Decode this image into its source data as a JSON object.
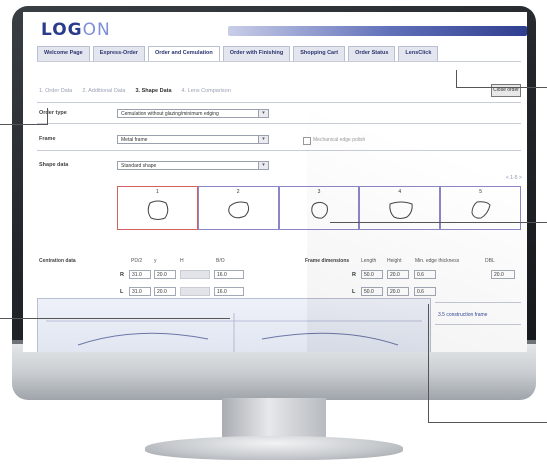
{
  "logo": {
    "left": "LOG",
    "right": "ON"
  },
  "nav": {
    "tabs": [
      "Welcome Page",
      "Express-Order",
      "Order and Cemulation",
      "Order with Finishing",
      "Shopping Cart",
      "Order Status",
      "LensClick"
    ],
    "active_index": 2
  },
  "steps": {
    "items": [
      "1. Order Data",
      "2. Additional Data",
      "3. Shape Data",
      "4. Lens Comparison"
    ],
    "current_index": 2
  },
  "close_button": "Close order",
  "form": {
    "order_type": {
      "label": "Order type",
      "value": "Cemulation without glazing/minimum edging"
    },
    "frame": {
      "label": "Frame",
      "value": "Metal frame",
      "checkbox_label": "Mechanical edge polish"
    },
    "shape_data": {
      "label": "Shape data",
      "value": "Standard shape"
    }
  },
  "shapes": {
    "pager": "< 1-5 >",
    "items": [
      {
        "number": "1",
        "selected": true,
        "icon": "lens-shape-rounded-square"
      },
      {
        "number": "2",
        "selected": false,
        "icon": "lens-shape-oval"
      },
      {
        "number": "3",
        "selected": false,
        "icon": "lens-shape-round"
      },
      {
        "number": "4",
        "selected": false,
        "icon": "lens-shape-wide"
      },
      {
        "number": "5",
        "selected": false,
        "icon": "lens-shape-teardrop"
      }
    ]
  },
  "centration": {
    "label": "Centration data",
    "columns": [
      "PD/2",
      "y",
      "H",
      "B/O"
    ],
    "rows": [
      {
        "side": "R",
        "values": [
          "31.0",
          "20.0",
          "",
          "16.0"
        ]
      },
      {
        "side": "L",
        "values": [
          "31.0",
          "20.0",
          "",
          "16.0"
        ]
      }
    ]
  },
  "frame_dimensions": {
    "label": "Frame dimensions",
    "columns": [
      "Length",
      "Height",
      "Min. edge thickness",
      "DBL"
    ],
    "rows": [
      {
        "side": "R",
        "values": [
          "50.0",
          "20.0",
          "0.6"
        ]
      },
      {
        "side": "L",
        "values": [
          "50.0",
          "20.0",
          "0.6"
        ]
      }
    ],
    "dbl": "20.0"
  },
  "panel_ticks": [
    "",
    "",
    ""
  ],
  "side_links": [
    "3.5 construction frame",
    ""
  ],
  "colors": {
    "brand": "#2b3c8c",
    "brand_light": "#7f8fd8",
    "selected_border": "#d46060",
    "box_border": "#8c86c8"
  }
}
